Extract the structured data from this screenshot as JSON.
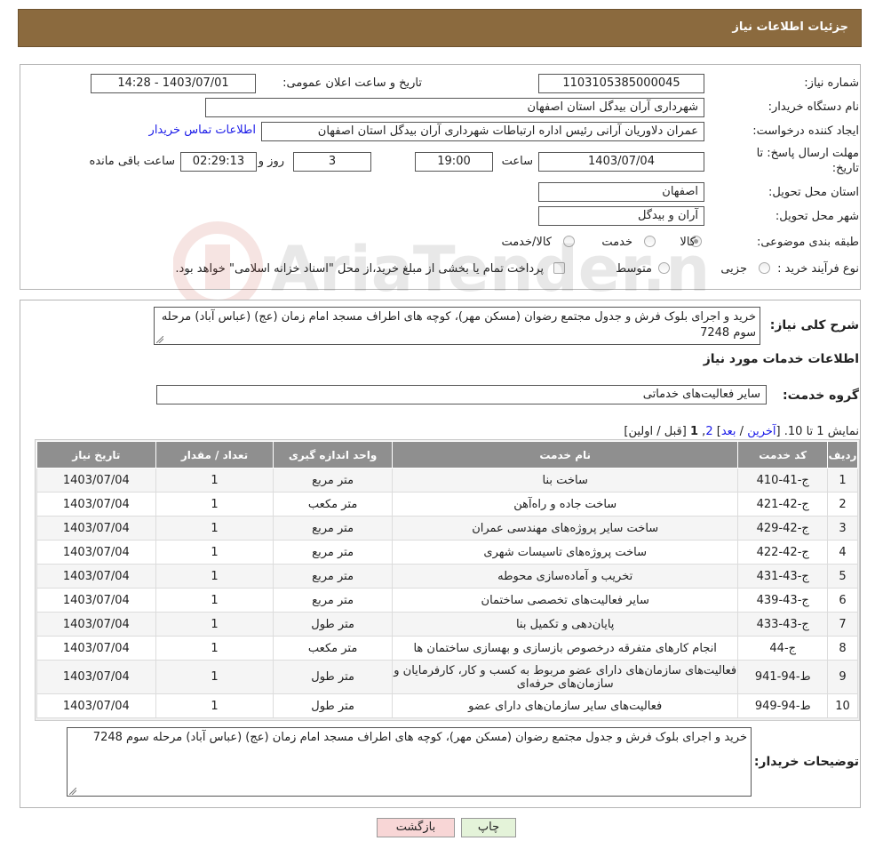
{
  "header": {
    "title": "جزئیات اطلاعات نیاز"
  },
  "info": {
    "need_number_label": "شماره نیاز:",
    "need_number": "1103105385000045",
    "announce_label": "تاریخ و ساعت اعلان عمومی:",
    "announce_value": "1403/07/01 - 14:28",
    "buyer_org_label": "نام دستگاه خریدار:",
    "buyer_org": "شهرداری آران بیدگل استان اصفهان",
    "requester_label": "ایجاد کننده درخواست:",
    "requester": "عمران دلاوریان آرانی رئیس اداره ارتباطات شهرداری آران بیدگل استان اصفهان",
    "contact_link": "اطلاعات تماس خریدار",
    "deadline_label_1": "مهلت ارسال پاسخ: تا",
    "deadline_label_2": "تاریخ:",
    "deadline_date": "1403/07/04",
    "time_label": "ساعت",
    "deadline_time": "19:00",
    "days_value": "3",
    "days_label": "روز و",
    "remaining_value": "02:29:13",
    "remaining_label": "ساعت باقی مانده",
    "province_label": "استان محل تحویل:",
    "province": "اصفهان",
    "city_label": "شهر محل تحویل:",
    "city": "آران و بیدگل",
    "category_label": "طبقه بندی موضوعی:",
    "category_options": [
      "کالا",
      "خدمت",
      "کالا/خدمت"
    ],
    "category_selected": "کالا",
    "process_label": "نوع فرآیند خرید :",
    "process_options": [
      "جزیی",
      "متوسط"
    ],
    "payment_note": "پرداخت تمام یا بخشی از مبلغ خرید،از محل \"اسناد خزانه اسلامی\" خواهد بود."
  },
  "details": {
    "summary_label": "شرح کلی نیاز:",
    "summary": "خرید و اجرای بلوک فرش و جدول مجتمع رضوان (مسکن مهر)، کوچه های اطراف مسجد امام زمان (عج) (عباس آباد) مرحله سوم 7248",
    "services_title": "اطلاعات خدمات مورد نیاز",
    "service_group_label": "گروه خدمت:",
    "service_group": "سایر فعالیت‌های خدماتی",
    "paging_prefix": "نمایش 1 تا 10.",
    "paging_bracket_open": "[",
    "paging_last": "آخرین",
    "paging_sep1": "/",
    "paging_next": "بعد",
    "paging_bracket_close": "]",
    "paging_page2": "2",
    "paging_comma": ",",
    "paging_page1": "1",
    "paging_prev_first": "[قبل / اولین]",
    "buyer_desc_label": "توضیحات خریدار:",
    "buyer_desc": "خرید و اجرای بلوک فرش و جدول مجتمع رضوان (مسکن مهر)، کوچه های اطراف مسجد امام زمان (عج) (عباس آباد) مرحله سوم 7248"
  },
  "table": {
    "headers": [
      "ردیف",
      "کد خدمت",
      "نام خدمت",
      "واحد اندازه گیری",
      "تعداد / مقدار",
      "تاریخ نیاز"
    ],
    "rows": [
      [
        "1",
        "ج-41-410",
        "ساخت بنا",
        "متر مربع",
        "1",
        "1403/07/04"
      ],
      [
        "2",
        "ج-42-421",
        "ساخت جاده و راه‌آهن",
        "متر مکعب",
        "1",
        "1403/07/04"
      ],
      [
        "3",
        "ج-42-429",
        "ساخت سایر پروژه‌های مهندسی عمران",
        "متر مربع",
        "1",
        "1403/07/04"
      ],
      [
        "4",
        "ج-42-422",
        "ساخت پروژه‌های تاسیسات شهری",
        "متر مربع",
        "1",
        "1403/07/04"
      ],
      [
        "5",
        "ج-43-431",
        "تخریب و آماده‌سازی محوطه",
        "متر مربع",
        "1",
        "1403/07/04"
      ],
      [
        "6",
        "ج-43-439",
        "سایر فعالیت‌های تخصصی ساختمان",
        "متر مربع",
        "1",
        "1403/07/04"
      ],
      [
        "7",
        "ج-43-433",
        "پایان‌دهی و تکمیل بنا",
        "متر طول",
        "1",
        "1403/07/04"
      ],
      [
        "8",
        "ج-44",
        "انجام کارهای متفرقه درخصوص بازسازی و بهسازی ساختمان ها",
        "متر مکعب",
        "1",
        "1403/07/04"
      ],
      [
        "9",
        "ط-94-941",
        "فعالیت‌های سازمان‌های دارای عضو مربوط به کسب و کار، کارفرمایان و سازمان‌های حرفه‌ای",
        "متر طول",
        "1",
        "1403/07/04"
      ],
      [
        "10",
        "ط-94-949",
        "فعالیت‌های سایر سازمان‌های دارای عضو",
        "متر طول",
        "1",
        "1403/07/04"
      ]
    ]
  },
  "buttons": {
    "back": "بازگشت",
    "print": "چاپ"
  },
  "watermark_text": "AriaTender.neT",
  "colors": {
    "header_bg": "#8b6a3e",
    "table_header_bg": "#8f8f8f",
    "back_btn": "#f8d6d6",
    "print_btn": "#e4f3d9"
  }
}
